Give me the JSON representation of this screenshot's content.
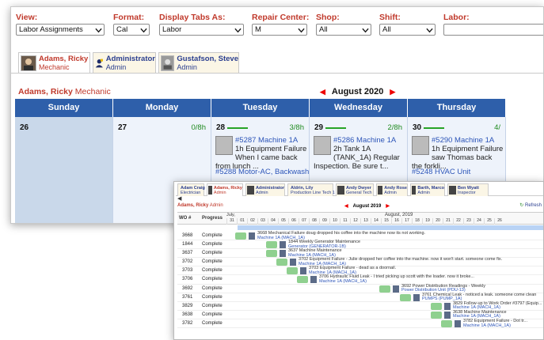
{
  "filters": [
    {
      "label": "View:",
      "value": "Labor Assignments"
    },
    {
      "label": "Format:",
      "value": "Cal"
    },
    {
      "label": "Display Tabs As:",
      "value": "Labor"
    },
    {
      "label": "Repair Center:",
      "value": "M"
    },
    {
      "label": "Shop:",
      "value": "All"
    },
    {
      "label": "Shift:",
      "value": "All"
    },
    {
      "label": "Labor:",
      "value": ""
    }
  ],
  "tabs": [
    {
      "name": "Adams, Ricky",
      "role": "Mechanic",
      "icon": "person-photo-icon"
    },
    {
      "name": "Administrator",
      "role": "Admin",
      "icon": "admin-user-icon"
    },
    {
      "name": "Gustafson, Steve",
      "role": "Admin",
      "icon": "person-photo-icon"
    }
  ],
  "current_user": {
    "name": "Adams, Ricky",
    "role": "Mechanic"
  },
  "month": "August 2020",
  "days": [
    {
      "name": "Sunday",
      "num": "26",
      "hours": "",
      "shaded": true
    },
    {
      "name": "Monday",
      "num": "27",
      "hours": "0/8h",
      "shaded": false
    },
    {
      "name": "Tuesday",
      "num": "28",
      "hours": "3/8h",
      "shaded": false,
      "event": {
        "link": "#5287 Machine 1A",
        "text": "1h Equipment Failure When I came back from lunch ..."
      },
      "event2": "#5288 Motor-AC, Backwash"
    },
    {
      "name": "Wednesday",
      "num": "29",
      "hours": "2/8h",
      "shaded": false,
      "event": {
        "link": "#5286 Machine 1A",
        "text": "2h Tank 1A (TANK_1A) Regular Inspection. Be sure t..."
      }
    },
    {
      "name": "Thursday",
      "num": "30",
      "hours": "4/",
      "shaded": false,
      "event": {
        "link": "#5290 Machine 1A",
        "text": "1h Equipment Failure saw Thomas back the forkli..."
      },
      "event2": "#5248 HVAC Unit"
    }
  ],
  "gantt": {
    "tabs": [
      {
        "name": "Adam Craig",
        "role": "Electrician"
      },
      {
        "name": "Adams, Ricky",
        "role": "Admin"
      },
      {
        "name": "Administrator",
        "role": "Admin"
      },
      {
        "name": "Aldrin, Lily",
        "role": "Production Line Tech 1"
      },
      {
        "name": "Andy Dwyer",
        "role": "General Tech"
      },
      {
        "name": "Andy Rose",
        "role": "Admin"
      },
      {
        "name": "Barth, Marco",
        "role": "Admin"
      },
      {
        "name": "Ben Wyatt",
        "role": "Inspector"
      }
    ],
    "current_user": {
      "name": "Adams, Ricky",
      "role": "Admin"
    },
    "month": "August 2019",
    "refresh": "Refresh",
    "col_wo": "WO #",
    "col_progress": "Progress",
    "month_label": "August, 2019",
    "prev_month_label": "July,",
    "day_numbers": [
      "31",
      "01",
      "02",
      "03",
      "04",
      "05",
      "06",
      "07",
      "08",
      "09",
      "10",
      "11",
      "12",
      "13",
      "14",
      "15",
      "16",
      "17",
      "18",
      "19",
      "20",
      "21",
      "22",
      "23",
      "24",
      "25",
      "26"
    ],
    "rows": [
      {
        "wo": "3668",
        "progress": "Complete",
        "bar_day": 0,
        "desc": "3668 Mechanical Failure doug dropped his coffee into the machine now its not working.",
        "sub": "Machine 1A (MACH_1A)"
      },
      {
        "wo": "1844",
        "progress": "Complete",
        "bar_day": 3,
        "desc": "1844 Weekly Generator Maintenance",
        "sub": "Generator (GENERATOR-1B)"
      },
      {
        "wo": "3637",
        "progress": "Complete",
        "bar_day": 3,
        "desc": "3637 Machine Maintenance",
        "sub": "Machine 1A (MACH_1A)"
      },
      {
        "wo": "3702",
        "progress": "Complete",
        "bar_day": 4,
        "desc": "3702 Equipment Failure - Julie dropped her coffee into the machine. now it won't start. someone come fix.",
        "sub": "Machine 1A (MACH_1A)"
      },
      {
        "wo": "3703",
        "progress": "Complete",
        "bar_day": 5,
        "desc": "3703 Equipment Failure - dead as a doornail.",
        "sub": "Machine 1A (MACH_1A)"
      },
      {
        "wo": "3706",
        "progress": "Complete",
        "bar_day": 6,
        "desc": "3706 Hydraulic Fluid Leak - I tried picking up scott with the loader. now it broke...",
        "sub": "Machine 1A (MACH_1A)"
      },
      {
        "wo": "3692",
        "progress": "Complete",
        "bar_day": 14,
        "desc": "3692 Power Distribution Readings - Weekly",
        "sub": "Power Distribution Unit (PDU-13)"
      },
      {
        "wo": "3761",
        "progress": "Complete",
        "bar_day": 16,
        "desc": "3761 Chemical Leak - noticed a leak. someone come clean",
        "sub": "PUMPS (PUMP_1A)"
      },
      {
        "wo": "3829",
        "progress": "Complete",
        "bar_day": 19,
        "desc": "3829 Follow-up to Work Order #3797 (Equip...",
        "sub": "Machine 1A (MACH_1A)"
      },
      {
        "wo": "3638",
        "progress": "Complete",
        "bar_day": 19,
        "desc": "3638 Machine Maintenance",
        "sub": "Machine 1A (MACH_1A)"
      },
      {
        "wo": "3782",
        "progress": "Complete",
        "bar_day": 20,
        "desc": "3782 Equipment Failure - Dot tr...",
        "sub": "Machine 1A (MACH_1A)"
      }
    ]
  },
  "colors": {
    "accent_red": "#c0392b",
    "header_blue": "#2e5faa",
    "link_blue": "#2d55b8",
    "hours_green": "#1e8a1e"
  }
}
